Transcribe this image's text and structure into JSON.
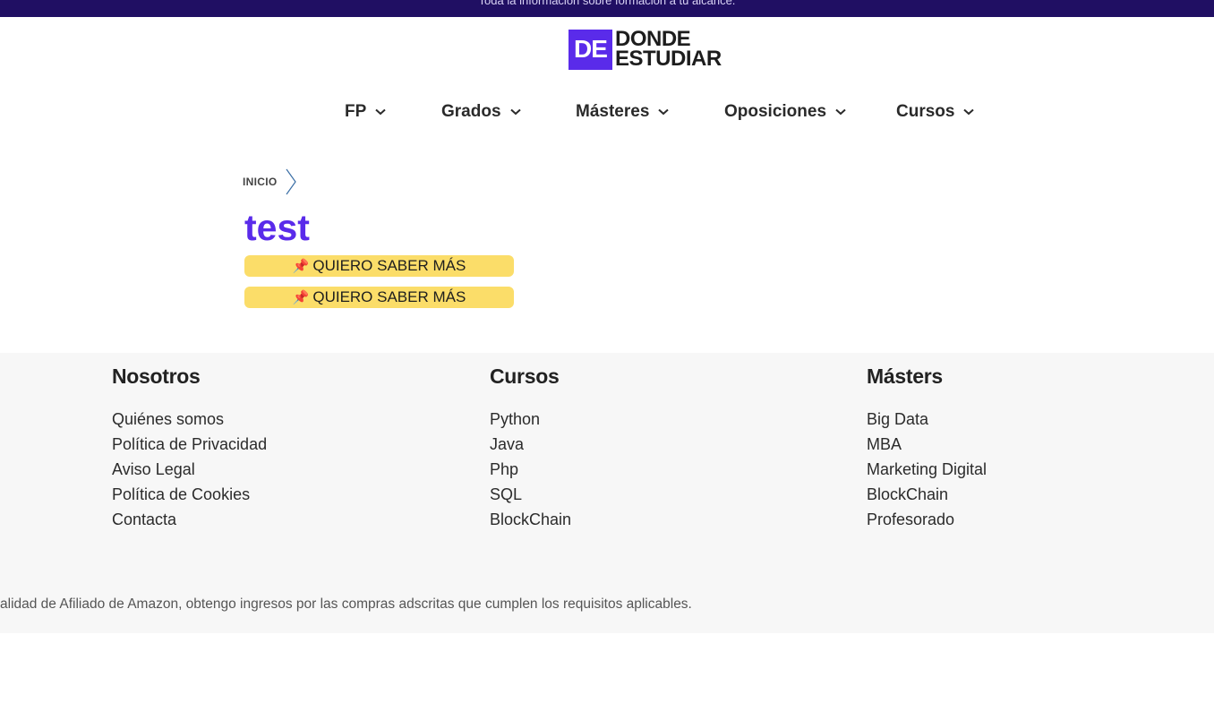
{
  "topbar": {
    "text": "Toda la información sobre formación a tu alcance."
  },
  "logo": {
    "box": "DE",
    "line1": "DONDE",
    "line2": "ESTUDIAR"
  },
  "nav": [
    {
      "label": "FP"
    },
    {
      "label": "Grados"
    },
    {
      "label": "Másteres"
    },
    {
      "label": "Oposiciones"
    },
    {
      "label": "Cursos"
    }
  ],
  "breadcrumb": {
    "home": "INICIO"
  },
  "page": {
    "title": "test"
  },
  "cta": {
    "label": "QUIERO SABER MÁS",
    "icon": "pushpin-icon"
  },
  "footer": {
    "columns": [
      {
        "title": "Nosotros",
        "links": [
          "Quiénes somos",
          "Política de Privacidad",
          "Aviso Legal",
          "Política de Cookies",
          "Contacta"
        ]
      },
      {
        "title": "Cursos",
        "links": [
          "Python",
          "Java",
          "Php",
          "SQL",
          "BlockChain"
        ]
      },
      {
        "title": "Másters",
        "links": [
          "Big Data",
          "MBA",
          "Marketing Digital",
          "BlockChain",
          "Profesorado"
        ]
      }
    ],
    "note": "alidad de Afiliado de Amazon, obtengo ingresos por las compras adscritas que cumplen los requisitos aplicables."
  },
  "colors": {
    "brand": "#5a2bea",
    "topbar": "#200f63",
    "cta": "#fbdd69",
    "footer_bg": "#f7f7f7"
  }
}
